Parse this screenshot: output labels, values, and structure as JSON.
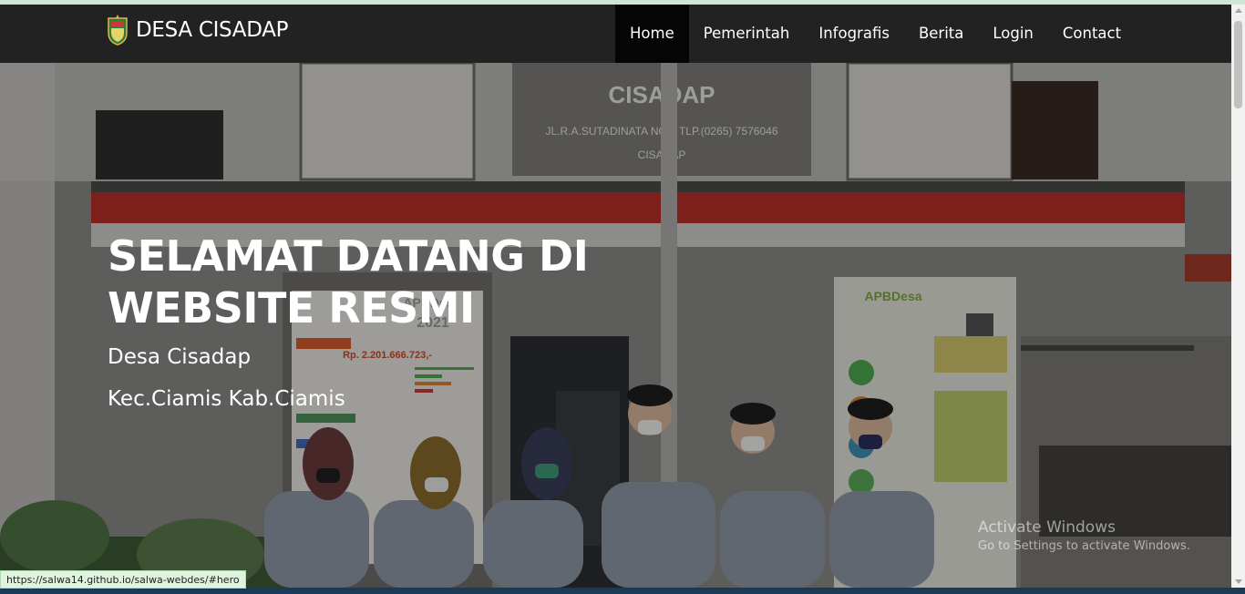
{
  "brand": {
    "name": "DESA CISADAP",
    "logo_icon": "village-shield-logo-icon"
  },
  "nav": {
    "items": [
      {
        "label": "Home",
        "active": true
      },
      {
        "label": "Pemerintah",
        "active": false
      },
      {
        "label": "Infografis",
        "active": false
      },
      {
        "label": "Berita",
        "active": false
      },
      {
        "label": "Login",
        "active": false
      },
      {
        "label": "Contact",
        "active": false
      }
    ]
  },
  "hero": {
    "title": "SELAMAT DATANG DI WEBSITE RESMI",
    "subtitle": "Desa Cisadap",
    "location": "Kec.Ciamis Kab.Ciamis",
    "background": {
      "building_sign_title": "CISADAP",
      "building_sign_address": "JL.R.A.SUTADINATA NO.6 TLP.(0265) 7576046",
      "building_sign_footer": "CISADAP",
      "left_banner_heading": "APBDes",
      "left_banner_year": "2021",
      "left_banner_amount": "Rp. 2.201.666.723,-",
      "right_banner_heading": "APBDesa"
    }
  },
  "status_bar": {
    "url": "https://salwa14.github.io/salwa-webdes/#hero"
  },
  "watermark": {
    "title": "Activate Windows",
    "subtitle": "Go to Settings to activate Windows."
  },
  "colors": {
    "navbar": "#222222",
    "active_nav": "#050505",
    "text": "#ffffff"
  }
}
